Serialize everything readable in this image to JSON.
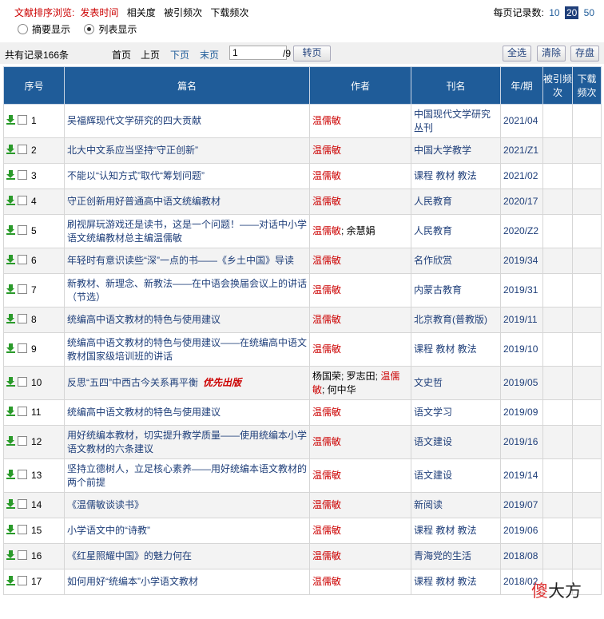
{
  "sort": {
    "label": "文献排序浏览:",
    "active": "发表时间",
    "options": [
      "相关度",
      "被引频次",
      "下载频次"
    ]
  },
  "perpage": {
    "label": "每页记录数:",
    "options": [
      "10",
      "20",
      "50"
    ],
    "selected": "20"
  },
  "view": {
    "abstract": "摘要显示",
    "list": "列表显示"
  },
  "pager": {
    "total": "共有记录166条",
    "first": "首页",
    "prev": "上页",
    "next": "下页",
    "last": "末页",
    "page_value": "1",
    "page_total": "/9",
    "goto": "转页",
    "select_all": "全选",
    "clear": "清除",
    "save": "存盘"
  },
  "headers": {
    "seq": "序号",
    "title": "篇名",
    "author": "作者",
    "journal": "刊名",
    "year": "年/期",
    "cited": "被引频次",
    "downloads": "下载频次"
  },
  "rows": [
    {
      "n": "1",
      "title": "吴福辉现代文学研究的四大贡献",
      "authors": [
        {
          "name": "温儒敏",
          "red": true
        }
      ],
      "journal": "中国现代文学研究丛刊",
      "year": "2021/04",
      "h": "r1"
    },
    {
      "n": "2",
      "title": "北大中文系应当坚持“守正创新”",
      "authors": [
        {
          "name": "温儒敏",
          "red": true
        }
      ],
      "journal": "中国大学教学",
      "year": "2021/Z1",
      "h": "r2"
    },
    {
      "n": "3",
      "title": "不能以“认知方式”取代“筹划问题”",
      "authors": [
        {
          "name": "温儒敏",
          "red": true
        }
      ],
      "journal": "课程 教材 教法",
      "year": "2021/02",
      "h": "r2"
    },
    {
      "n": "4",
      "title": "守正创新用好普通高中语文统编教材",
      "authors": [
        {
          "name": "温儒敏",
          "red": true
        }
      ],
      "journal": "人民教育",
      "year": "2020/17",
      "h": "r2"
    },
    {
      "n": "5",
      "title": "刷视屏玩游戏还是读书，这是一个问题！——对话中小学语文统编教材总主编温儒敏",
      "authors": [
        {
          "name": "温儒敏",
          "red": true
        },
        {
          "name": "; 余慧娟",
          "red": false
        }
      ],
      "journal": "人民教育",
      "year": "2020/Z2",
      "h": "r1"
    },
    {
      "n": "6",
      "title": "年轻时有意识读些“深”一点的书——《乡土中国》导读",
      "authors": [
        {
          "name": "温儒敏",
          "red": true
        }
      ],
      "journal": "名作欣赏",
      "year": "2019/34",
      "h": "r2"
    },
    {
      "n": "7",
      "title": "新教材、新理念、新教法——在中语会换届会议上的讲话（节选）",
      "authors": [
        {
          "name": "温儒敏",
          "red": true
        }
      ],
      "journal": "内蒙古教育",
      "year": "2019/31",
      "h": "r1"
    },
    {
      "n": "8",
      "title": "统编高中语文教材的特色与使用建议",
      "authors": [
        {
          "name": "温儒敏",
          "red": true
        }
      ],
      "journal": "北京教育(普教版)",
      "year": "2019/11",
      "h": "r2"
    },
    {
      "n": "9",
      "title": "统编高中语文教材的特色与使用建议——在统编高中语文教材国家级培训班的讲话",
      "authors": [
        {
          "name": "温儒敏",
          "red": true
        }
      ],
      "journal": "课程 教材 教法",
      "year": "2019/10",
      "h": "r1"
    },
    {
      "n": "10",
      "title": "反思“五四”中西古今关系再平衡",
      "badge": "优先出版",
      "authors": [
        {
          "name": "杨国荣; 罗志田; ",
          "red": false
        },
        {
          "name": "温儒敏",
          "red": true
        },
        {
          "name": "; 何中华",
          "red": false
        }
      ],
      "journal": "文史哲",
      "year": "2019/05",
      "h": "r1"
    },
    {
      "n": "11",
      "title": "统编高中语文教材的特色与使用建议",
      "authors": [
        {
          "name": "温儒敏",
          "red": true
        }
      ],
      "journal": "语文学习",
      "year": "2019/09",
      "h": "r2"
    },
    {
      "n": "12",
      "title": "用好统编本教材，切实提升教学质量——使用统编本小学语文教材的六条建议",
      "authors": [
        {
          "name": "温儒敏",
          "red": true
        }
      ],
      "journal": "语文建设",
      "year": "2019/16",
      "h": "r1"
    },
    {
      "n": "13",
      "title": "坚持立德树人，立足核心素养——用好统编本语文教材的两个前提",
      "authors": [
        {
          "name": "温儒敏",
          "red": true
        }
      ],
      "journal": "语文建设",
      "year": "2019/14",
      "h": "r1"
    },
    {
      "n": "14",
      "title": "《温儒敏谈读书》",
      "authors": [
        {
          "name": "温儒敏",
          "red": true
        }
      ],
      "journal": "新阅读",
      "year": "2019/07",
      "h": "r2"
    },
    {
      "n": "15",
      "title": "小学语文中的“诗教”",
      "authors": [
        {
          "name": "温儒敏",
          "red": true
        }
      ],
      "journal": "课程 教材 教法",
      "year": "2019/06",
      "h": "r2"
    },
    {
      "n": "16",
      "title": "《红星照耀中国》的魅力何在",
      "authors": [
        {
          "name": "温儒敏",
          "red": true
        }
      ],
      "journal": "青海党的生活",
      "year": "2018/08",
      "h": "r2"
    },
    {
      "n": "17",
      "title": "如何用好“统编本”小学语文教材",
      "authors": [
        {
          "name": "温儒敏",
          "red": true
        }
      ],
      "journal": "课程 教材 教法",
      "year": "2018/02",
      "h": "r2"
    }
  ],
  "watermark": {
    "part1": "傻",
    "part2": "大方"
  }
}
